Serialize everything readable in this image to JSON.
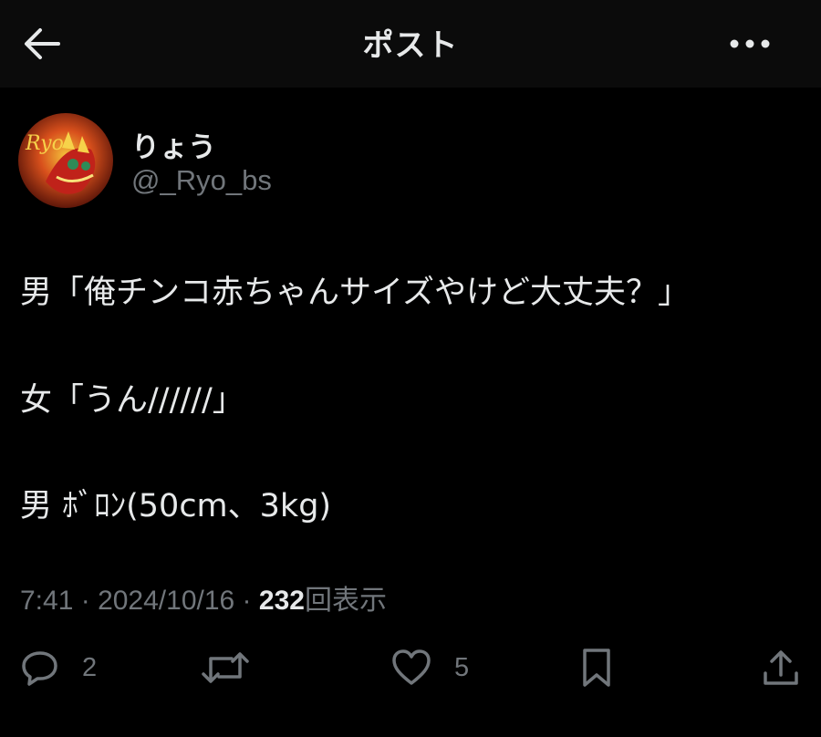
{
  "header": {
    "title": "ポスト",
    "back_icon": "arrow-left-icon",
    "more_icon": "more-horizontal-icon"
  },
  "author": {
    "display_name": "りょう",
    "handle": "@_Ryo_bs",
    "avatar_text": "Ryo"
  },
  "post": {
    "lines": [
      "男「俺チンコ赤ちゃんサイズやけど大丈夫？」",
      "女「うん//////」",
      "男 ﾎﾞﾛﾝ(50cm、3kg)"
    ]
  },
  "meta": {
    "time": "7:41",
    "sep": " · ",
    "date": "2024/10/16",
    "views": "232",
    "views_label": "回表示"
  },
  "actions": {
    "reply_count": "2",
    "retweet_count": "",
    "like_count": "5"
  },
  "colors": {
    "background": "#000000",
    "header_bg": "#0b0b0b",
    "text": "#e7e9ea",
    "muted": "#71767b"
  }
}
